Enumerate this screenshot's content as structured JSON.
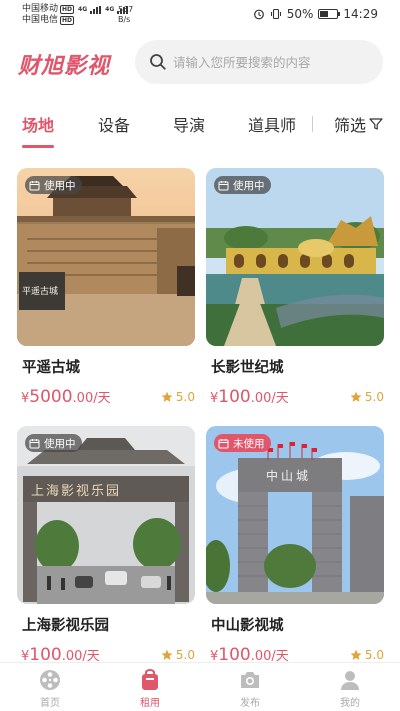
{
  "status_bar": {
    "carrier1": "中国移动",
    "carrier2": "中国电信",
    "hd": "HD",
    "network": "4G",
    "speed_value": "567",
    "speed_unit": "B/s",
    "battery": "50%",
    "time": "14:29"
  },
  "header": {
    "logo": "财旭影视",
    "search_placeholder": "请输入您所要搜索的内容"
  },
  "tabs": [
    {
      "label": "场地",
      "active": true
    },
    {
      "label": "设备",
      "active": false
    },
    {
      "label": "导演",
      "active": false
    },
    {
      "label": "道具师",
      "active": false
    }
  ],
  "filter_label": "筛选",
  "cards": [
    {
      "name": "平遥古城",
      "status": "使用中",
      "price_symbol": "¥",
      "price": "5000",
      "price_decimal": ".00",
      "unit": "/天",
      "rating": "5.0"
    },
    {
      "name": "长影世纪城",
      "status": "使用中",
      "price_symbol": "¥",
      "price": "100",
      "price_decimal": ".00",
      "unit": "/天",
      "rating": "5.0"
    },
    {
      "name": "上海影视乐园",
      "status": "使用中",
      "price_symbol": "¥",
      "price": "100",
      "price_decimal": ".00",
      "unit": "/天",
      "rating": "5.0"
    },
    {
      "name": "中山影视城",
      "status": "未使用",
      "price_symbol": "¥",
      "price": "100",
      "price_decimal": ".00",
      "unit": "/天",
      "rating": "5.0"
    }
  ],
  "image_text": {
    "pingyao_sign": "平遥古城",
    "shanghai_gate": "上海影视乐园",
    "zhongshan_gate": "中山城"
  },
  "bottom_nav": [
    {
      "label": "首页",
      "icon": "film-reel-icon",
      "active": false
    },
    {
      "label": "租用",
      "icon": "rent-bag-icon",
      "active": true
    },
    {
      "label": "发布",
      "icon": "camera-icon",
      "active": false
    },
    {
      "label": "我的",
      "icon": "user-icon",
      "active": false
    }
  ],
  "colors": {
    "accent": "#e0566b",
    "star": "#e2a43a"
  }
}
